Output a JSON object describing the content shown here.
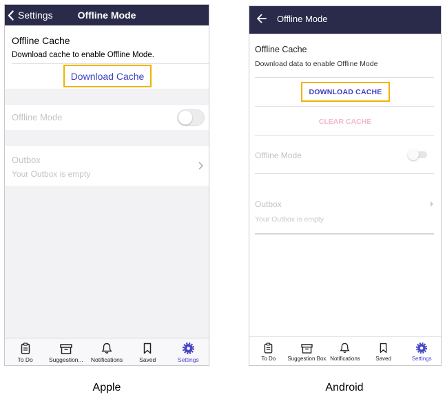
{
  "apple": {
    "caption": "Apple",
    "header": {
      "back_label": "Settings",
      "title": "Offline Mode"
    },
    "cache": {
      "title": "Offline Cache",
      "description": "Download cache to enable Offline Mode.",
      "download_label": "Download Cache"
    },
    "offline_mode": {
      "label": "Offline Mode",
      "enabled": false
    },
    "outbox": {
      "title": "Outbox",
      "subtitle": "Your Outbox is empty"
    },
    "tabs": [
      {
        "label": "To Do",
        "icon": "clipboard-icon"
      },
      {
        "label": "Suggestion...",
        "icon": "archive-box-icon"
      },
      {
        "label": "Notifications",
        "icon": "bell-icon"
      },
      {
        "label": "Saved",
        "icon": "bookmark-icon"
      },
      {
        "label": "Settings",
        "icon": "gear-icon",
        "active": true
      }
    ]
  },
  "android": {
    "caption": "Android",
    "header": {
      "title": "Offline Mode"
    },
    "cache": {
      "title": "Offline Cache",
      "description": "Download data to enable Offline Mode",
      "download_label": "DOWNLOAD CACHE",
      "clear_label": "CLEAR CACHE"
    },
    "offline_mode": {
      "label": "Offline Mode",
      "enabled": false
    },
    "outbox": {
      "title": "Outbox",
      "subtitle": "Your Outbox is empty"
    },
    "tabs": [
      {
        "label": "To Do",
        "icon": "clipboard-icon"
      },
      {
        "label": "Suggestion Box",
        "icon": "archive-box-icon"
      },
      {
        "label": "Notifications",
        "icon": "bell-icon"
      },
      {
        "label": "Saved",
        "icon": "bookmark-icon"
      },
      {
        "label": "Settings",
        "icon": "gear-icon",
        "active": true
      }
    ]
  },
  "colors": {
    "header": "#2a2a4a",
    "accent": "#4646c8",
    "highlight_border": "#f0b400",
    "disabled_text": "#c4c4c8",
    "clear_cache_disabled": "#f4b8c6"
  }
}
